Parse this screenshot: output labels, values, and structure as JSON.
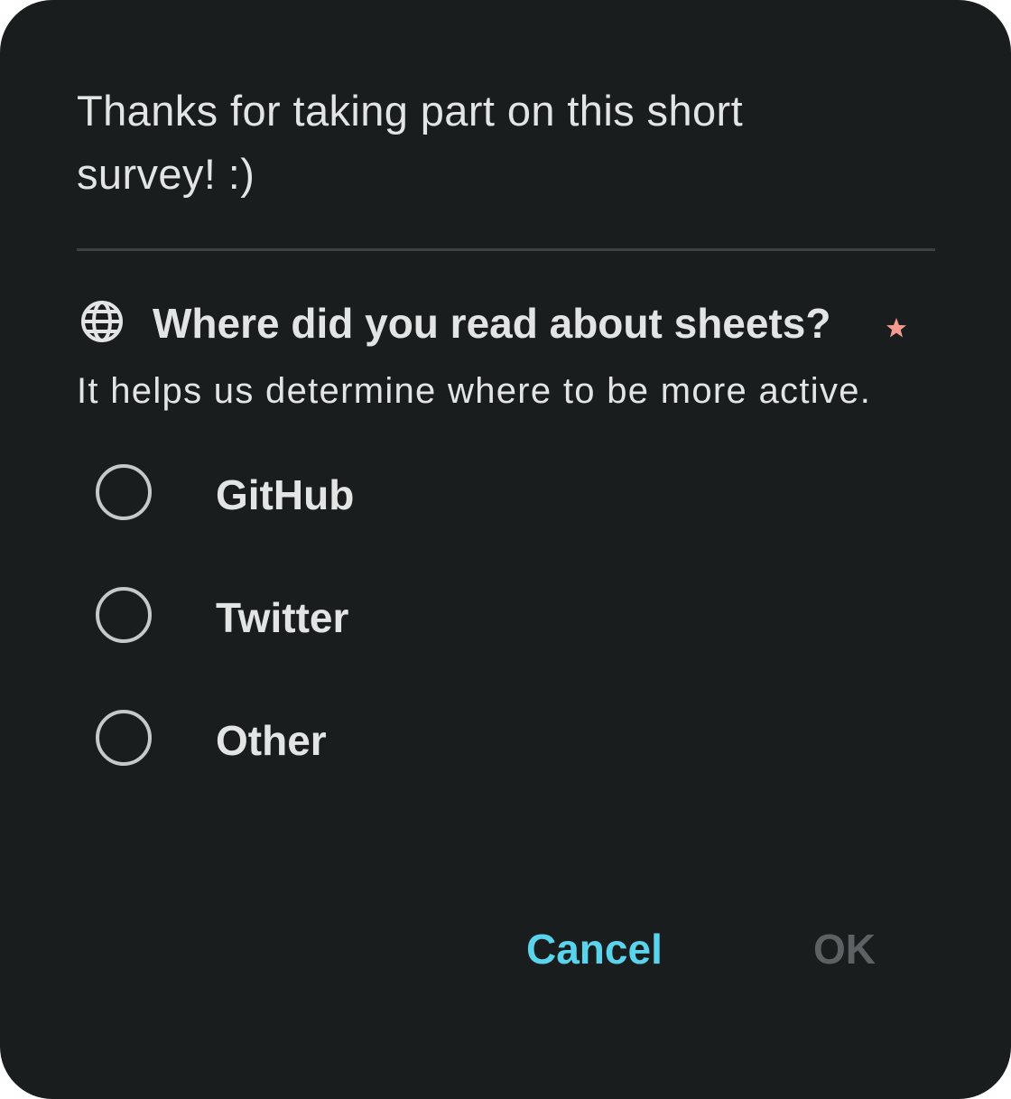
{
  "dialog": {
    "intro_text": "Thanks for taking part on this short survey! :)",
    "question": {
      "icon": "globe-icon",
      "title": "Where did you read about sheets?",
      "required_icon": "star-icon",
      "description": "It helps us determine where to be more active."
    },
    "options": [
      {
        "label": "GitHub",
        "selected": false
      },
      {
        "label": "Twitter",
        "selected": false
      },
      {
        "label": "Other",
        "selected": false
      }
    ],
    "actions": {
      "cancel_label": "Cancel",
      "ok_label": "OK",
      "ok_enabled": false
    }
  },
  "colors": {
    "background": "#1a1d1e",
    "text": "#e3e4e4",
    "accent": "#5ad3ec",
    "disabled": "#5d6163",
    "required_star": "#f59c8f",
    "radio_outline": "#c4c9cb",
    "divider": "#3d4142"
  }
}
